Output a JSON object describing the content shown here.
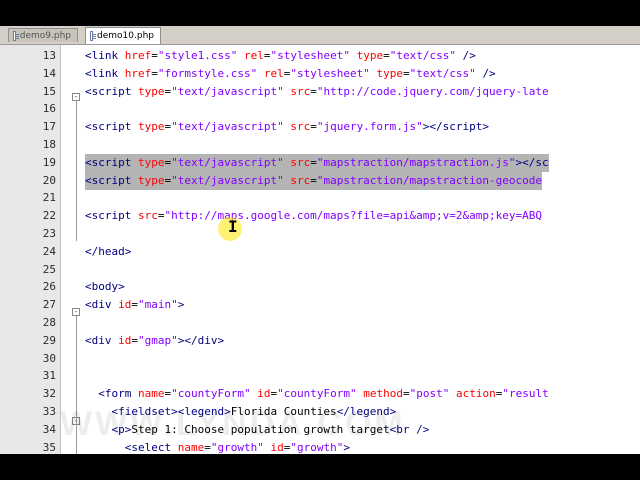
{
  "tabs": [
    {
      "label": "demo9.php"
    },
    {
      "label": "demo10.php"
    }
  ],
  "watermark": "WWW.LYNDA.COM",
  "lines": [
    {
      "num": "13",
      "html": "<span class='t'>&lt;link</span> <span class='a'>href</span><span class='x'>=</span><span class='v'>\"style1.css\"</span> <span class='a'>rel</span><span class='x'>=</span><span class='v'>\"stylesheet\"</span> <span class='a'>type</span><span class='x'>=</span><span class='v'>\"text/css\"</span> <span class='t'>/&gt;</span>"
    },
    {
      "num": "14",
      "html": "<span class='t'>&lt;link</span> <span class='a'>href</span><span class='x'>=</span><span class='v'>\"formstyle.css\"</span> <span class='a'>rel</span><span class='x'>=</span><span class='v'>\"stylesheet\"</span> <span class='a'>type</span><span class='x'>=</span><span class='v'>\"text/css\"</span> <span class='t'>/&gt;</span>"
    },
    {
      "num": "15",
      "html": "<span class='t'>&lt;script</span> <span class='a'>type</span><span class='x'>=</span><span class='v'>\"text/javascript\"</span> <span class='a'>src</span><span class='x'>=</span><span class='v'>\"http://code.jquery.com/jquery-late</span>"
    },
    {
      "num": "16",
      "html": ""
    },
    {
      "num": "17",
      "html": "<span class='t'>&lt;script</span> <span class='a'>type</span><span class='x'>=</span><span class='v'>\"text/javascript\"</span> <span class='a'>src</span><span class='x'>=</span><span class='v'>\"jquery.form.js\"</span><span class='t'>&gt;&lt;/script&gt;</span>"
    },
    {
      "num": "18",
      "html": ""
    },
    {
      "num": "19",
      "sel": true,
      "html": "<span class='t'>&lt;script</span> <span class='a'>type</span><span class='x'>=</span><span class='v'>\"text/javascript\"</span> <span class='a'>src</span><span class='x'>=</span><span class='v'>\"mapstraction/mapstraction.js\"</span><span class='t'>&gt;&lt;/sc</span>"
    },
    {
      "num": "20",
      "sel": true,
      "html": "<span class='t'>&lt;script</span> <span class='a'>type</span><span class='x'>=</span><span class='v'>\"text/javascript\"</span> <span class='a'>src</span><span class='x'>=</span><span class='v'>\"mapstraction/mapstraction-geocode</span>"
    },
    {
      "num": "21",
      "html": ""
    },
    {
      "num": "22",
      "html": "<span class='t'>&lt;script</span> <span class='a'>src</span><span class='x'>=</span><span class='v'>\"http://maps.google.com/maps?file=api&amp;amp;v=2&amp;amp;key=ABQ</span>"
    },
    {
      "num": "23",
      "html": ""
    },
    {
      "num": "24",
      "html": "<span class='t'>&lt;/head&gt;</span>"
    },
    {
      "num": "25",
      "html": ""
    },
    {
      "num": "26",
      "html": "<span class='t'>&lt;body&gt;</span>"
    },
    {
      "num": "27",
      "html": "<span class='t'>&lt;div</span> <span class='a'>id</span><span class='x'>=</span><span class='v'>\"main\"</span><span class='t'>&gt;</span>"
    },
    {
      "num": "28",
      "html": ""
    },
    {
      "num": "29",
      "html": "<span class='t'>&lt;div</span> <span class='a'>id</span><span class='x'>=</span><span class='v'>\"gmap\"</span><span class='t'>&gt;&lt;/div&gt;</span>"
    },
    {
      "num": "30",
      "html": ""
    },
    {
      "num": "31",
      "html": ""
    },
    {
      "num": "32",
      "html": "  <span class='t'>&lt;form</span> <span class='a'>name</span><span class='x'>=</span><span class='v'>\"countyForm\"</span> <span class='a'>id</span><span class='x'>=</span><span class='v'>\"countyForm\"</span> <span class='a'>method</span><span class='x'>=</span><span class='v'>\"post\"</span> <span class='a'>action</span><span class='x'>=</span><span class='v'>\"result</span>"
    },
    {
      "num": "33",
      "html": "    <span class='t'>&lt;fieldset&gt;&lt;legend&gt;</span>Florida Counties<span class='t'>&lt;/legend&gt;</span>"
    },
    {
      "num": "34",
      "html": "    <span class='t'>&lt;p&gt;</span>Step 1: Choose population growth target<span class='t'>&lt;br /&gt;</span>"
    },
    {
      "num": "35",
      "html": "      <span class='t'>&lt;select</span> <span class='a'>name</span><span class='x'>=</span><span class='v'>\"growth\"</span> <span class='a'>id</span><span class='x'>=</span><span class='v'>\"growth\"</span><span class='t'>&gt;</span>"
    }
  ]
}
